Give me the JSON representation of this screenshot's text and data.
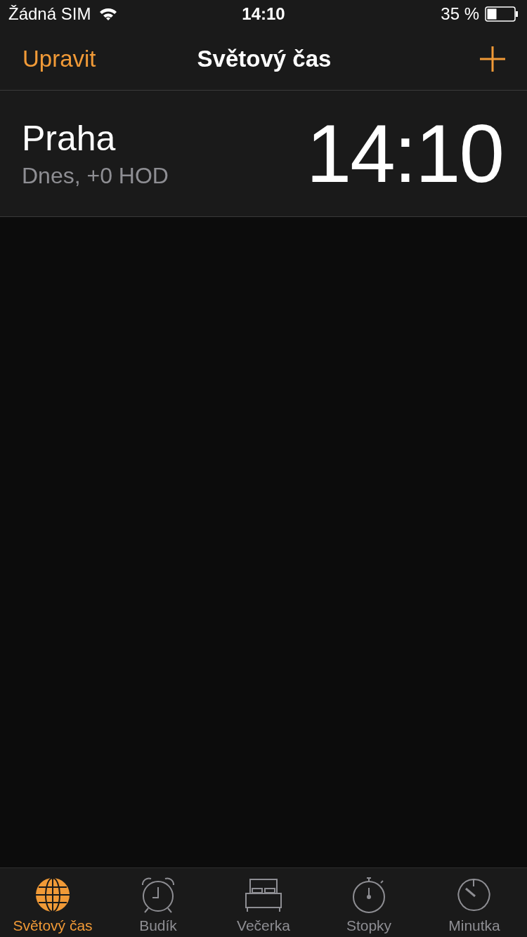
{
  "status_bar": {
    "carrier": "Žádná SIM",
    "time": "14:10",
    "battery": "35 %"
  },
  "nav_bar": {
    "edit": "Upravit",
    "title": "Světový čas"
  },
  "clocks": [
    {
      "city": "Praha",
      "offset": "Dnes, +0 HOD",
      "time": "14:10"
    }
  ],
  "tabs": [
    {
      "label": "Světový čas",
      "kind": "globe",
      "selected": true
    },
    {
      "label": "Budík",
      "kind": "alarm",
      "selected": false
    },
    {
      "label": "Večerka",
      "kind": "bed",
      "selected": false
    },
    {
      "label": "Stopky",
      "kind": "stopwatch",
      "selected": false
    },
    {
      "label": "Minutka",
      "kind": "timer",
      "selected": false
    }
  ]
}
